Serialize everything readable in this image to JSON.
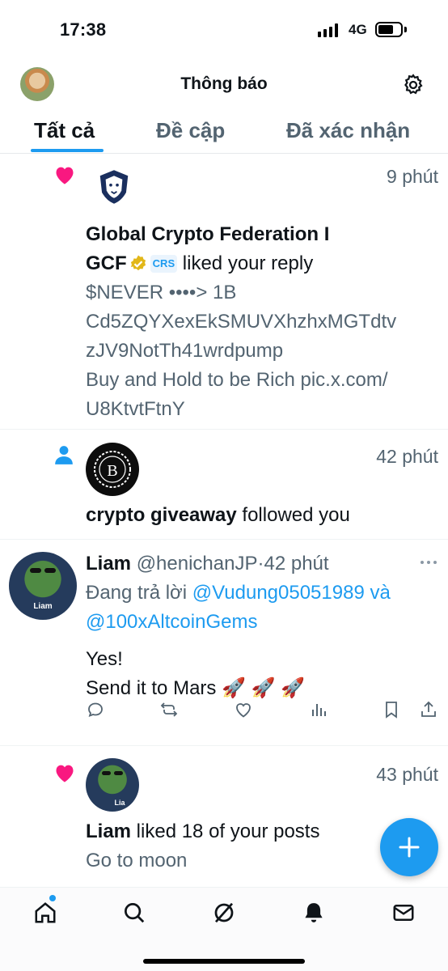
{
  "status": {
    "time": "17:38",
    "network": "4G"
  },
  "header": {
    "title": "Thông báo"
  },
  "tabs": [
    {
      "label": "Tất cả"
    },
    {
      "label": "Đề cập"
    },
    {
      "label": "Đã xác nhận"
    }
  ],
  "notifications": [
    {
      "time": "9 phút",
      "name_line1": "Global Crypto Federation I",
      "name_line2": "GCF",
      "badge_text": "CRS",
      "action": " liked your reply",
      "content_lines": [
        "$NEVER ••••> 1B",
        "Cd5ZQYXexEkSMUVXhzhxMGTdtv",
        "zJV9NotTh41wrdpump",
        "Buy and Hold to be Rich pic.x.com/",
        "U8KtvtFtnY"
      ]
    },
    {
      "time": "42 phút",
      "name": "crypto giveaway",
      "action": " followed you"
    },
    {
      "name": "Liam",
      "handle": "@henichanJP",
      "separator": "·",
      "time": "42 phút",
      "reply_prefix": "Đang trả lời ",
      "reply_user1": "@Vudung05051989",
      "reply_and": " và",
      "reply_user2": "@100xAltcoinGems",
      "text_line1": "Yes!",
      "text_line2": "Send it to Mars 🚀 🚀 🚀",
      "avatar_label": "Liam"
    },
    {
      "time": "43 phút",
      "name": "Liam",
      "action": " liked 18 of your posts",
      "content": "Go to moon",
      "avatar_label": "Lia"
    }
  ],
  "colors": {
    "accent": "#1d9bf0",
    "like": "#f91880",
    "text": "#0f1419",
    "secondary": "#536471"
  }
}
